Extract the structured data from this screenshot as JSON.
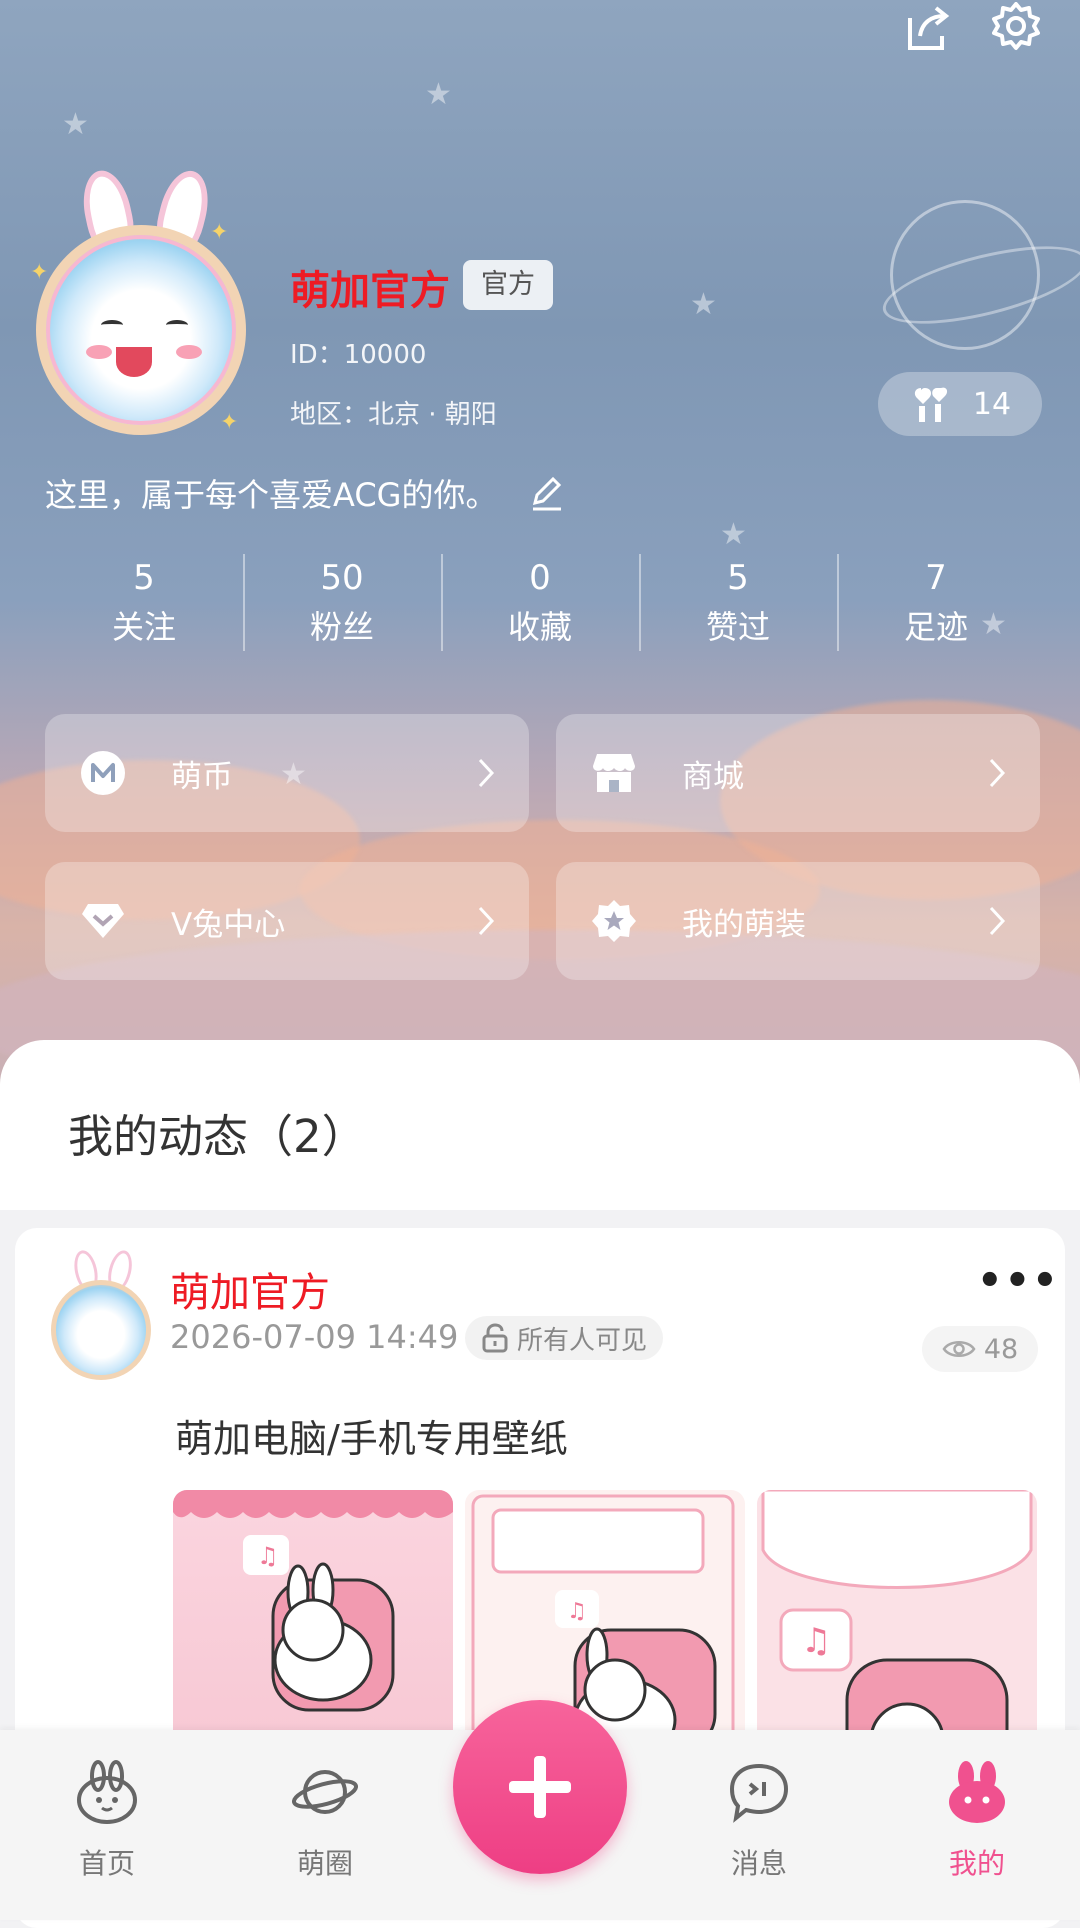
{
  "profile": {
    "name": "萌加官方",
    "tag": "官方",
    "id_text": "ID：10000",
    "region_text": "地区：北京 · 朝阳",
    "popularity": "14",
    "bio": "这里，属于每个喜爱ACG的你。"
  },
  "stats": [
    {
      "value": "5",
      "label": "关注"
    },
    {
      "value": "50",
      "label": "粉丝"
    },
    {
      "value": "0",
      "label": "收藏"
    },
    {
      "value": "5",
      "label": "赞过"
    },
    {
      "value": "7",
      "label": "足迹"
    }
  ],
  "cards": [
    {
      "label": "萌币",
      "icon": "coin-m-icon"
    },
    {
      "label": "商城",
      "icon": "shop-icon"
    },
    {
      "label": "V兔中心",
      "icon": "diamond-icon"
    },
    {
      "label": "我的萌装",
      "icon": "badge-star-icon"
    }
  ],
  "section_title": "我的动态（2）",
  "post": {
    "author": "萌加官方",
    "time": "2026-07-09 14:49",
    "visibility": "所有人可见",
    "views": "48",
    "text": "萌加电脑/手机专用壁纸"
  },
  "nav": [
    {
      "label": "首页",
      "icon": "bunny-home-icon",
      "active": false
    },
    {
      "label": "萌圈",
      "icon": "planet-icon",
      "active": false
    },
    {
      "label": "消息",
      "icon": "chat-icon",
      "active": false
    },
    {
      "label": "我的",
      "icon": "bunny-me-icon",
      "active": true
    }
  ],
  "colors": {
    "accent": "#ee3e84",
    "name_red": "#ee1b24",
    "active_nav": "#f0518f"
  }
}
